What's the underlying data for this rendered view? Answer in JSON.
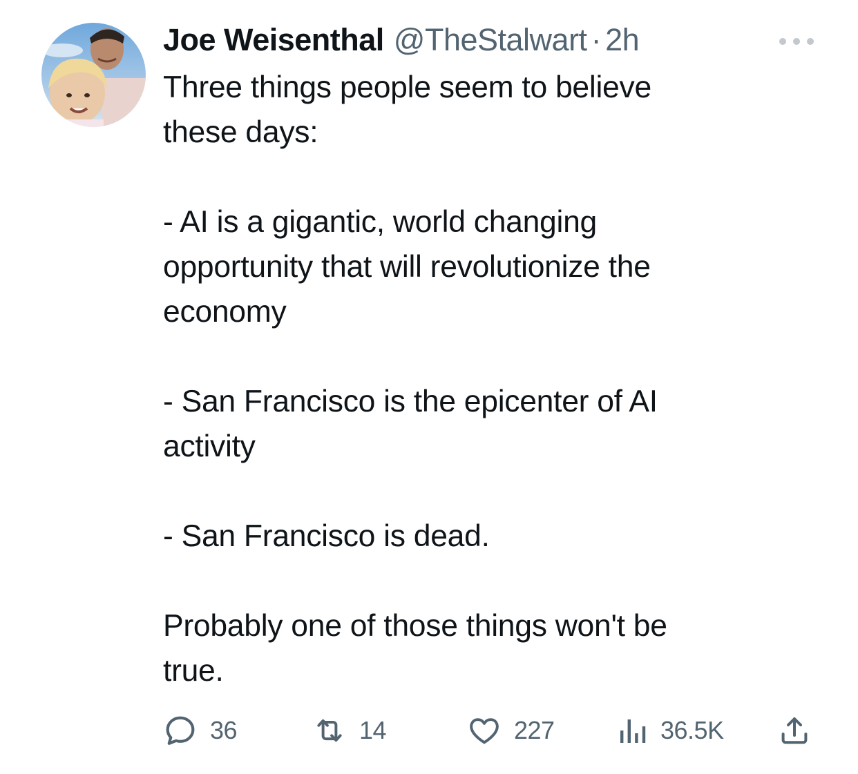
{
  "tweet": {
    "author": {
      "display_name": "Joe Weisenthal",
      "handle": "@TheStalwart",
      "separator": "·",
      "time": "2h",
      "avatar_icon": "profile-photo"
    },
    "more_icon": "more-dots-icon",
    "paragraphs": [
      "Three things people seem to believe\nthese days:",
      "- AI is a gigantic, world changing\nopportunity that will revolutionize the\neconomy",
      "- San Francisco is the epicenter of AI\nactivity",
      "- San Francisco is dead.",
      "Probably one of those things won't be\ntrue."
    ],
    "actions": {
      "replies": "36",
      "retweets": "14",
      "likes": "227",
      "views": "36.5K"
    }
  },
  "colors": {
    "text": "#0f1419",
    "secondary": "#536471",
    "background": "#ffffff"
  }
}
